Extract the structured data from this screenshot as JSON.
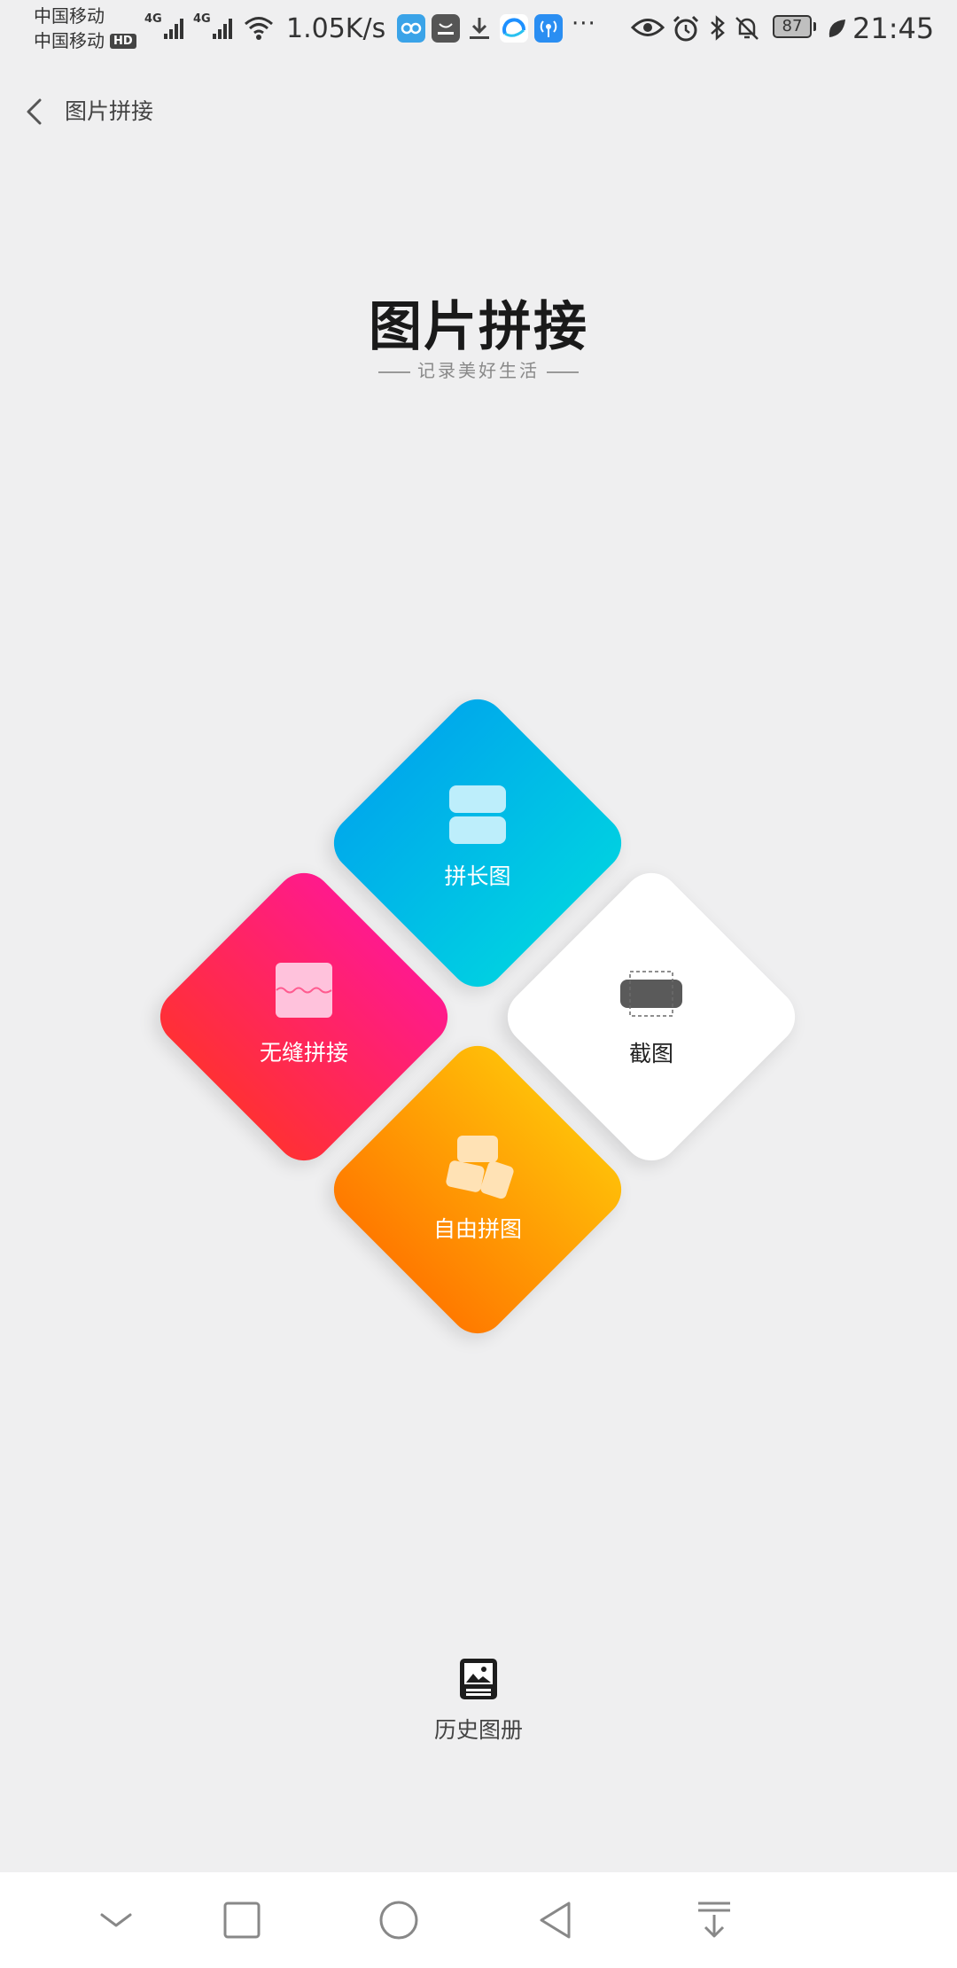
{
  "status_bar": {
    "carrier_1": "中国移动",
    "carrier_2": "中国移动",
    "hd_badge": "HD",
    "signal_tag_1": "4G",
    "signal_tag_2": "4G",
    "net_speed": "1.05K/s",
    "more_dots": "···",
    "battery_level": "87",
    "time": "21:45"
  },
  "nav": {
    "title": "图片拼接"
  },
  "logo": {
    "title": "图片拼接",
    "subtitle": "记录美好生活"
  },
  "tiles": {
    "long": "拼长图",
    "seamless": "无缝拼接",
    "screenshot": "截图",
    "free": "自由拼图"
  },
  "history": {
    "label": "历史图册"
  },
  "colors": {
    "blue": "#00aaeb",
    "pink": "#ff1a8c",
    "orange": "#ffa000",
    "white": "#ffffff"
  }
}
